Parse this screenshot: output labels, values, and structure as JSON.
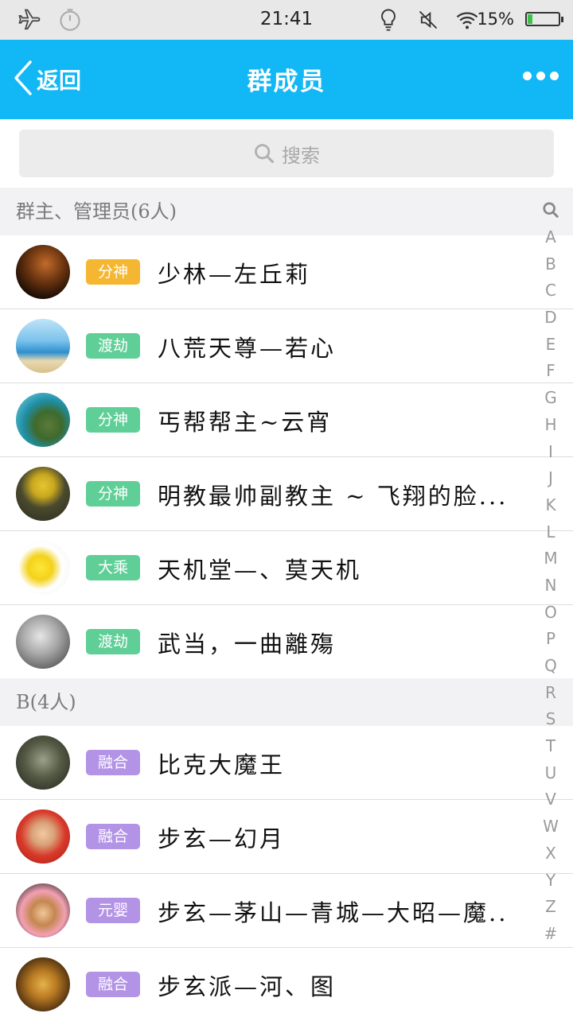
{
  "status_bar": {
    "time": "21:41",
    "battery": "15%",
    "icons": [
      "airplane-icon",
      "timer-icon",
      "bulb-icon",
      "mute-icon",
      "wifi-icon",
      "battery-icon"
    ],
    "battery_level": 0.15
  },
  "nav": {
    "back_label": "返回",
    "title": "群成员",
    "more_icon": "more-dots-icon"
  },
  "search": {
    "placeholder": "搜索"
  },
  "sections": [
    {
      "header": "群主、管理员(6人)",
      "members": [
        {
          "badge": "分神",
          "badge_color": "#f5b731",
          "name": "少林—左丘莉"
        },
        {
          "badge": "渡劫",
          "badge_color": "#5fcf97",
          "name": "八荒天尊—若心"
        },
        {
          "badge": "分神",
          "badge_color": "#5fcf97",
          "name": "丐帮帮主~云宵"
        },
        {
          "badge": "分神",
          "badge_color": "#5fcf97",
          "name": "明教最帅副教主 ~ 飞翔的脸..."
        },
        {
          "badge": "大乘",
          "badge_color": "#5fcf97",
          "name": "天机堂—、莫天机"
        },
        {
          "badge": "渡劫",
          "badge_color": "#5fcf97",
          "name": "武当，一曲離殤"
        }
      ]
    },
    {
      "header": "B(4人)",
      "members": [
        {
          "badge": "融合",
          "badge_color": "#b393e6",
          "name": "比克大魔王"
        },
        {
          "badge": "融合",
          "badge_color": "#b393e6",
          "name": "步玄—幻月"
        },
        {
          "badge": "元婴",
          "badge_color": "#b393e6",
          "name": "步玄—茅山—青城—大昭—魔..."
        },
        {
          "badge": "融合",
          "badge_color": "#b393e6",
          "name": "步玄派—河、图"
        }
      ]
    }
  ],
  "index_bar": [
    "A",
    "B",
    "C",
    "D",
    "E",
    "F",
    "G",
    "H",
    "I",
    "J",
    "K",
    "L",
    "M",
    "N",
    "O",
    "P",
    "Q",
    "R",
    "S",
    "T",
    "U",
    "V",
    "W",
    "X",
    "Y",
    "Z",
    "#"
  ],
  "colors": {
    "nav_bg": "#12b7f5",
    "section_bg": "#f2f2f4"
  }
}
